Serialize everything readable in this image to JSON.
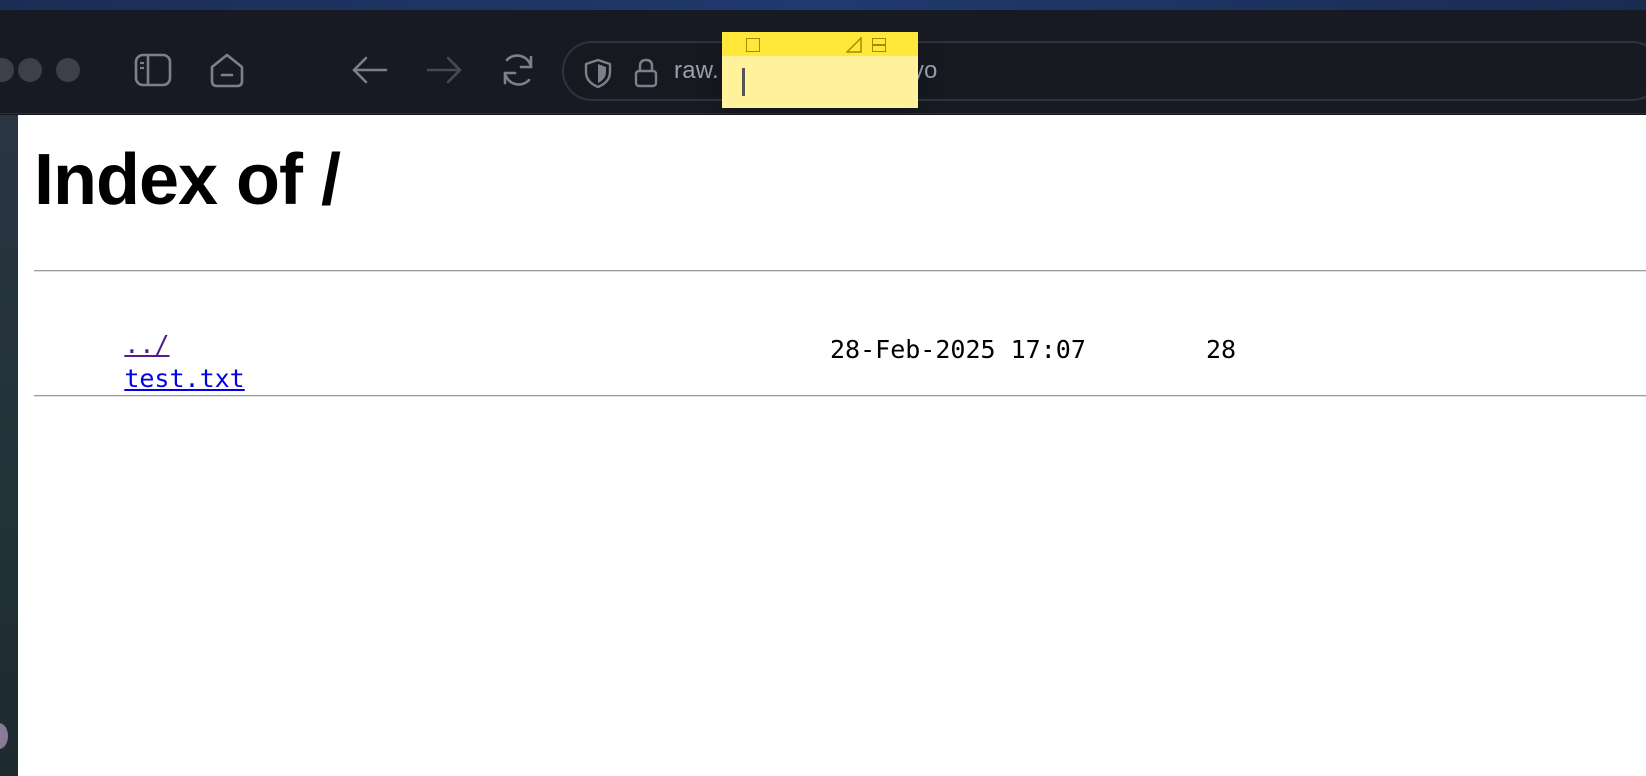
{
  "browser": {
    "url_prefix": "raw.",
    "url_suffix": "yo",
    "icons": {
      "sidebar": "sidebar-icon",
      "home": "home-icon",
      "back": "back-arrow-icon",
      "forward": "forward-arrow-icon",
      "reload": "reload-icon",
      "shield": "shield-icon",
      "lock": "lock-icon"
    }
  },
  "page": {
    "title": "Index of /",
    "entries": [
      {
        "name": "../",
        "date": "",
        "size": ""
      },
      {
        "name": "test.txt",
        "date": "28-Feb-2025 17:07",
        "size": "28"
      }
    ]
  },
  "sticky_note": {
    "text": "",
    "color": "#fff29a"
  },
  "colors": {
    "link": "#0000ee",
    "visited_link": "#551a8b",
    "toolbar_bg": "#171a22"
  }
}
